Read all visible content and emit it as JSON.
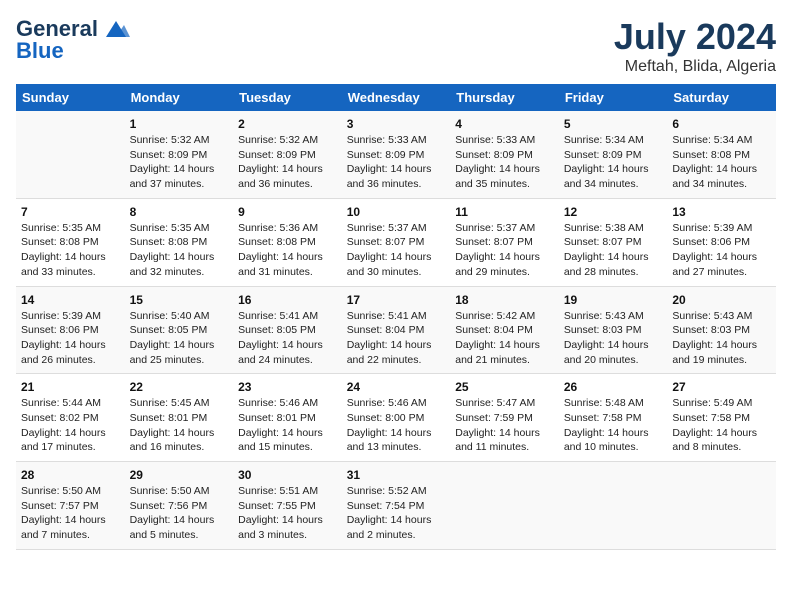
{
  "logo": {
    "line1": "General",
    "line2": "Blue"
  },
  "title": "July 2024",
  "subtitle": "Meftah, Blida, Algeria",
  "days_of_week": [
    "Sunday",
    "Monday",
    "Tuesday",
    "Wednesday",
    "Thursday",
    "Friday",
    "Saturday"
  ],
  "weeks": [
    [
      {
        "num": "",
        "sunrise": "",
        "sunset": "",
        "daylight": ""
      },
      {
        "num": "1",
        "sunrise": "5:32 AM",
        "sunset": "8:09 PM",
        "daylight": "14 hours and 37 minutes."
      },
      {
        "num": "2",
        "sunrise": "5:32 AM",
        "sunset": "8:09 PM",
        "daylight": "14 hours and 36 minutes."
      },
      {
        "num": "3",
        "sunrise": "5:33 AM",
        "sunset": "8:09 PM",
        "daylight": "14 hours and 36 minutes."
      },
      {
        "num": "4",
        "sunrise": "5:33 AM",
        "sunset": "8:09 PM",
        "daylight": "14 hours and 35 minutes."
      },
      {
        "num": "5",
        "sunrise": "5:34 AM",
        "sunset": "8:09 PM",
        "daylight": "14 hours and 34 minutes."
      },
      {
        "num": "6",
        "sunrise": "5:34 AM",
        "sunset": "8:08 PM",
        "daylight": "14 hours and 34 minutes."
      }
    ],
    [
      {
        "num": "7",
        "sunrise": "5:35 AM",
        "sunset": "8:08 PM",
        "daylight": "14 hours and 33 minutes."
      },
      {
        "num": "8",
        "sunrise": "5:35 AM",
        "sunset": "8:08 PM",
        "daylight": "14 hours and 32 minutes."
      },
      {
        "num": "9",
        "sunrise": "5:36 AM",
        "sunset": "8:08 PM",
        "daylight": "14 hours and 31 minutes."
      },
      {
        "num": "10",
        "sunrise": "5:37 AM",
        "sunset": "8:07 PM",
        "daylight": "14 hours and 30 minutes."
      },
      {
        "num": "11",
        "sunrise": "5:37 AM",
        "sunset": "8:07 PM",
        "daylight": "14 hours and 29 minutes."
      },
      {
        "num": "12",
        "sunrise": "5:38 AM",
        "sunset": "8:07 PM",
        "daylight": "14 hours and 28 minutes."
      },
      {
        "num": "13",
        "sunrise": "5:39 AM",
        "sunset": "8:06 PM",
        "daylight": "14 hours and 27 minutes."
      }
    ],
    [
      {
        "num": "14",
        "sunrise": "5:39 AM",
        "sunset": "8:06 PM",
        "daylight": "14 hours and 26 minutes."
      },
      {
        "num": "15",
        "sunrise": "5:40 AM",
        "sunset": "8:05 PM",
        "daylight": "14 hours and 25 minutes."
      },
      {
        "num": "16",
        "sunrise": "5:41 AM",
        "sunset": "8:05 PM",
        "daylight": "14 hours and 24 minutes."
      },
      {
        "num": "17",
        "sunrise": "5:41 AM",
        "sunset": "8:04 PM",
        "daylight": "14 hours and 22 minutes."
      },
      {
        "num": "18",
        "sunrise": "5:42 AM",
        "sunset": "8:04 PM",
        "daylight": "14 hours and 21 minutes."
      },
      {
        "num": "19",
        "sunrise": "5:43 AM",
        "sunset": "8:03 PM",
        "daylight": "14 hours and 20 minutes."
      },
      {
        "num": "20",
        "sunrise": "5:43 AM",
        "sunset": "8:03 PM",
        "daylight": "14 hours and 19 minutes."
      }
    ],
    [
      {
        "num": "21",
        "sunrise": "5:44 AM",
        "sunset": "8:02 PM",
        "daylight": "14 hours and 17 minutes."
      },
      {
        "num": "22",
        "sunrise": "5:45 AM",
        "sunset": "8:01 PM",
        "daylight": "14 hours and 16 minutes."
      },
      {
        "num": "23",
        "sunrise": "5:46 AM",
        "sunset": "8:01 PM",
        "daylight": "14 hours and 15 minutes."
      },
      {
        "num": "24",
        "sunrise": "5:46 AM",
        "sunset": "8:00 PM",
        "daylight": "14 hours and 13 minutes."
      },
      {
        "num": "25",
        "sunrise": "5:47 AM",
        "sunset": "7:59 PM",
        "daylight": "14 hours and 11 minutes."
      },
      {
        "num": "26",
        "sunrise": "5:48 AM",
        "sunset": "7:58 PM",
        "daylight": "14 hours and 10 minutes."
      },
      {
        "num": "27",
        "sunrise": "5:49 AM",
        "sunset": "7:58 PM",
        "daylight": "14 hours and 8 minutes."
      }
    ],
    [
      {
        "num": "28",
        "sunrise": "5:50 AM",
        "sunset": "7:57 PM",
        "daylight": "14 hours and 7 minutes."
      },
      {
        "num": "29",
        "sunrise": "5:50 AM",
        "sunset": "7:56 PM",
        "daylight": "14 hours and 5 minutes."
      },
      {
        "num": "30",
        "sunrise": "5:51 AM",
        "sunset": "7:55 PM",
        "daylight": "14 hours and 3 minutes."
      },
      {
        "num": "31",
        "sunrise": "5:52 AM",
        "sunset": "7:54 PM",
        "daylight": "14 hours and 2 minutes."
      },
      {
        "num": "",
        "sunrise": "",
        "sunset": "",
        "daylight": ""
      },
      {
        "num": "",
        "sunrise": "",
        "sunset": "",
        "daylight": ""
      },
      {
        "num": "",
        "sunrise": "",
        "sunset": "",
        "daylight": ""
      }
    ]
  ]
}
